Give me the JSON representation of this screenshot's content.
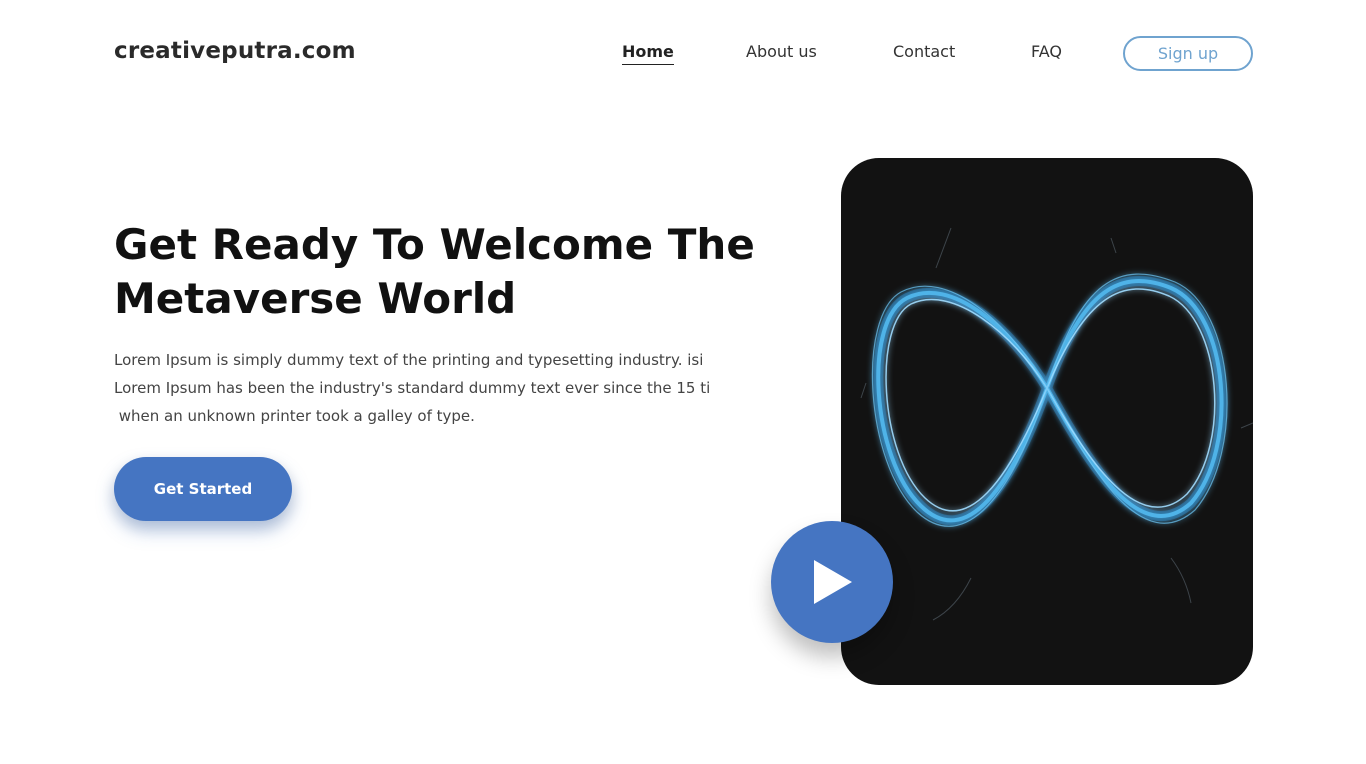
{
  "header": {
    "brand": "creativeputra.com",
    "nav": [
      {
        "label": "Home",
        "active": true
      },
      {
        "label": "About us",
        "active": false
      },
      {
        "label": "Contact",
        "active": false
      },
      {
        "label": "FAQ",
        "active": false
      }
    ],
    "signup_label": "Sign up"
  },
  "hero": {
    "title_line1": "Get Ready To Welcome The",
    "title_line2": "Metaverse World",
    "text_line1": "Lorem Ipsum is simply dummy text of the printing and typesetting industry. isi",
    "text_line2": "Lorem Ipsum has been the industry's standard dummy text ever since the 15 ti",
    "text_line3": " when an unknown printer took a galley of type.",
    "cta_label": "Get Started"
  },
  "media": {
    "image_icon": "infinity-icon",
    "play_icon": "play-icon"
  },
  "colors": {
    "accent": "#4575c2",
    "outline": "#6fa3cf",
    "card": "#121212",
    "glow": "#4fb3e8"
  }
}
